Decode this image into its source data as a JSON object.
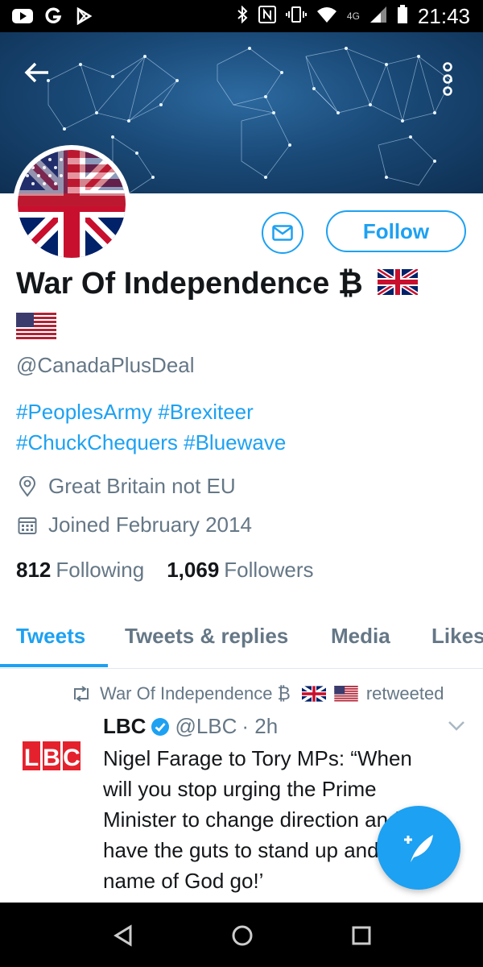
{
  "status_bar": {
    "time": "21:43",
    "network": "4G",
    "left_icons": [
      "youtube-icon",
      "google-icon",
      "play-store-icon"
    ],
    "right_icons": [
      "bluetooth-icon",
      "nfc-icon",
      "vibrate-icon",
      "wifi-icon",
      "signal-icon",
      "battery-icon"
    ]
  },
  "profile": {
    "name": "War Of Independence ₿",
    "handle": "@CanadaPlusDeal",
    "bio_line1": "#PeoplesArmy #Brexiteer",
    "bio_line2": "#ChuckChequers #Bluewave",
    "location": "Great Britain not EU",
    "joined": "Joined February 2014",
    "following_count": "812",
    "following_label": "Following",
    "followers_count": "1,069",
    "followers_label": "Followers",
    "follow_label": "Follow"
  },
  "tabs": [
    {
      "label": "Tweets",
      "active": true
    },
    {
      "label": "Tweets & replies",
      "active": false
    },
    {
      "label": "Media",
      "active": false
    },
    {
      "label": "Likes",
      "active": false
    }
  ],
  "tweet": {
    "retweeted_by": "War Of Independence ₿",
    "retweeted_label": "retweeted",
    "author_name": "LBC",
    "author_handle": "@LBC",
    "time": "· 2h",
    "logo_text": "LBC",
    "text": "Nigel Farage to Tory MPs: “When will you stop urging the Prime Minister to change direction and have the guts to stand up and ‘in the name of God go!’"
  },
  "colors": {
    "accent": "#1da1f2",
    "text_primary": "#14171a",
    "text_secondary": "#657786"
  }
}
